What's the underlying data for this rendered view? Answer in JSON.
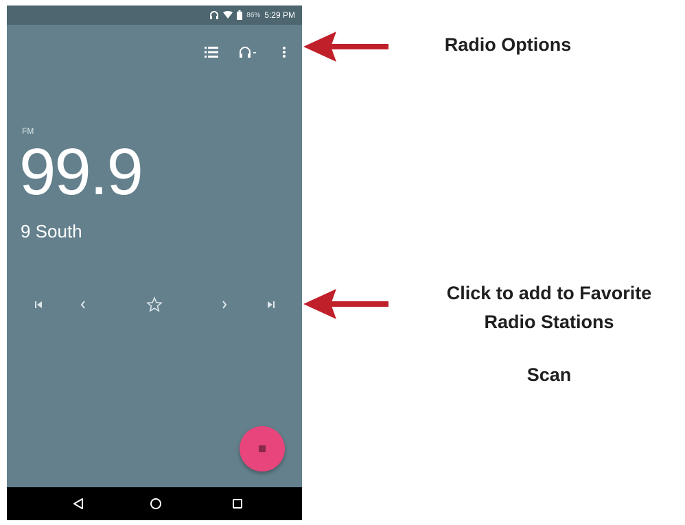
{
  "status_bar": {
    "headset_icon": "headphones-icon",
    "wifi_icon": "wifi-icon",
    "battery_icon": "battery-icon",
    "battery_percent": "86%",
    "time": "5:29 PM"
  },
  "toolbar": {
    "station_list_icon": "list-icon",
    "audio_output_icon": "headphones-dropdown-icon",
    "overflow_icon": "more-vert-icon"
  },
  "radio": {
    "band": "FM",
    "frequency": "99.9",
    "station_name": "9 South"
  },
  "controls": {
    "skip_previous": "skip-previous-icon",
    "seek_previous": "chevron-left-icon",
    "favorite": "star-outline-icon",
    "seek_next": "chevron-right-icon",
    "skip_next": "skip-next-icon"
  },
  "fab": {
    "icon": "stop-icon",
    "color": "#e8457c"
  },
  "nav_bar": {
    "back_icon": "back-triangle-icon",
    "home_icon": "home-circle-icon",
    "recents_icon": "recents-square-icon"
  },
  "annotations": {
    "radio_options": "Radio Options",
    "favorite_line1": "Click to add to Favorite",
    "favorite_line2": "Radio Stations",
    "scan": "Scan",
    "arrow_color": "#c0202a"
  },
  "colors": {
    "background": "#63808c",
    "status_bar": "#4d6670",
    "nav_bar": "#000000"
  }
}
